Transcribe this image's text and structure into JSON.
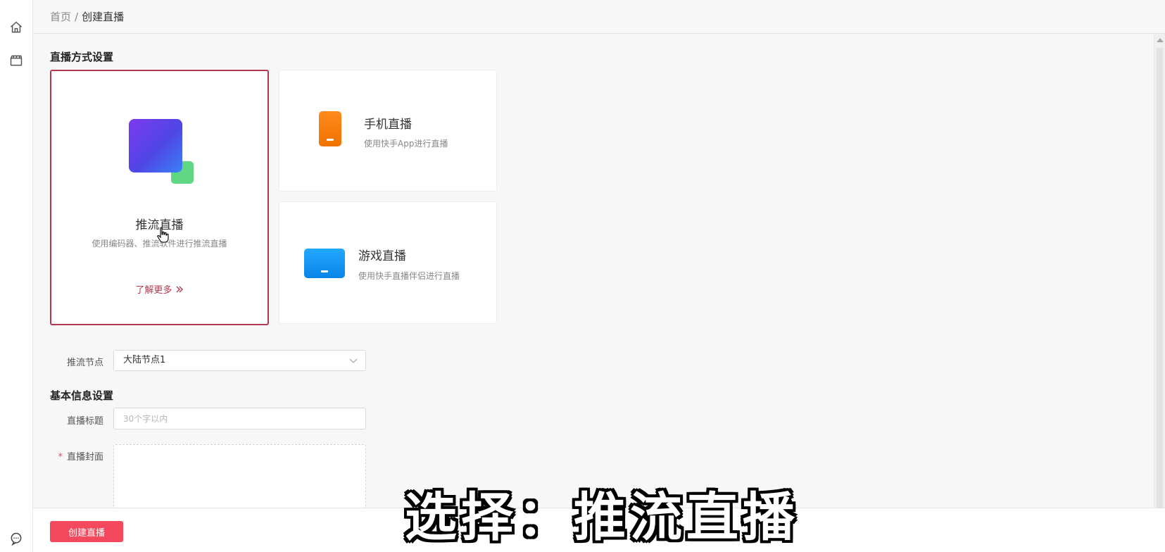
{
  "breadcrumb": {
    "home": "首页",
    "separator": "/",
    "current": "创建直播"
  },
  "sidebar": {
    "icons": [
      "home-icon",
      "clapperboard-icon",
      "chat-feedback-icon"
    ]
  },
  "sections": {
    "live_mode_title": "直播方式设置",
    "basic_info_title": "基本信息设置"
  },
  "options": {
    "push": {
      "title": "推流直播",
      "desc": "使用编码器、推流软件进行推流直播",
      "learn_more": "了解更多",
      "selected": true
    },
    "mobile": {
      "title": "手机直播",
      "desc": "使用快手App进行直播"
    },
    "game": {
      "title": "游戏直播",
      "desc": "使用快手直播伴侣进行直播"
    }
  },
  "form": {
    "node_label": "推流节点",
    "node_value": "大陆节点1",
    "title_label": "直播标题",
    "title_placeholder": "30个字以内",
    "cover_label": "直播封面",
    "cover_required_mark": "*"
  },
  "footer": {
    "create_button": "创建直播"
  },
  "overlay_subtitle": "选择：推流直播",
  "colors": {
    "accent": "#b3384f",
    "primary_button": "#f4485e",
    "mobile_icon": "#f58220",
    "game_icon": "#1a9af5",
    "push_icon_big": "#5b3ff0",
    "push_icon_small": "#5fd783"
  }
}
